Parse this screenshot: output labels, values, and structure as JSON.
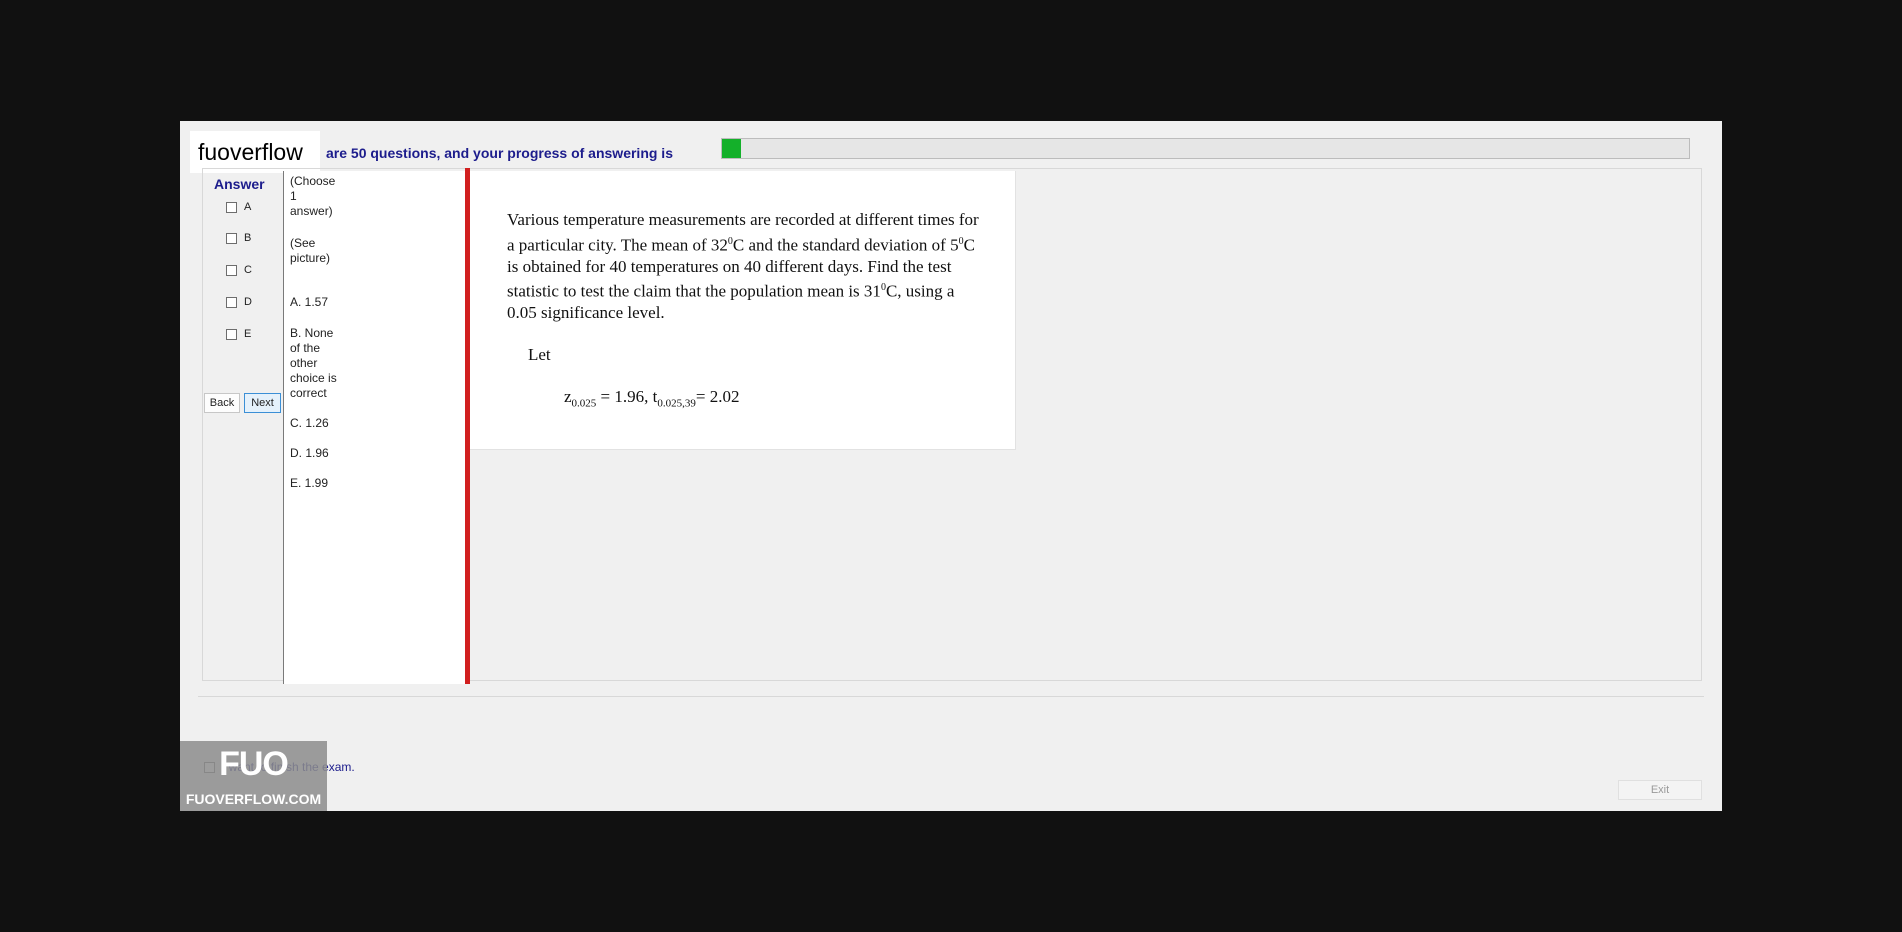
{
  "header": {
    "logo_text": "fuoverflow",
    "progress_text": "are 50 questions, and your progress of answering is",
    "progress_fraction": 0.02,
    "progress_color": "#14b02a"
  },
  "answer_panel": {
    "title": "Answer",
    "options": [
      "A",
      "B",
      "C",
      "D",
      "E"
    ],
    "back_label": "Back",
    "next_label": "Next"
  },
  "choices": {
    "instruction": "(Choose\n1\nanswer)",
    "see_picture": "(See\npicture)",
    "a": "A.  1.57",
    "b": "B.  None\nof the\nother\nchoice is\ncorrect",
    "c": "C.  1.26",
    "d": "D.  1.96",
    "e": "E.  1.99"
  },
  "question": {
    "text_1": "Various temperature measurements are recorded at different times for a particular city. The mean of 32",
    "sup_1": "0",
    "text_2": "C and the standard deviation of 5",
    "sup_2": "0",
    "text_3": "C is obtained for 40 temperatures on 40 different days. Find the test statistic to test the claim that the population mean is 31",
    "sup_3": "0",
    "text_4": "C, using a 0.05 significance level.",
    "let": "Let",
    "z_symbol": "z",
    "z_sub": "0.025",
    "z_value": " = 1.96,  ",
    "t_symbol": "t",
    "t_sub": "0.025,39",
    "t_value": "= 2.02"
  },
  "footer": {
    "finish_label": "I want to finish the exam.",
    "exit_label": "Exit"
  },
  "watermark": {
    "big": "FUO",
    "site": "FUOVERFLOW.COM"
  }
}
